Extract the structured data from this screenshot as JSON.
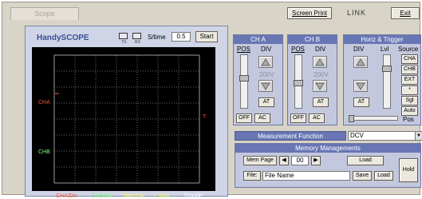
{
  "top": {
    "tab_scope": "Scope",
    "screen_print": "Screen Print",
    "link": "LINK",
    "exit": "Exit"
  },
  "scope": {
    "title": "HandySCOPE",
    "icon1_label": "TX",
    "icon2_label": "RX",
    "stime_label": "S/time",
    "stime_value": "0.5",
    "start_label": "Start",
    "cha_label": "CHA",
    "chb_label": "CHB",
    "trigger_marker": "T",
    "bottom": {
      "cha_div": "CHA/Div",
      "chb_div": "CHB/Div",
      "time_div": "Time/Div",
      "sour": "+  Sour",
      "tmode": "T/mode"
    }
  },
  "cha": {
    "title": "CH A",
    "pos": "POS",
    "div": "DIV",
    "div_value": "200V",
    "at": "AT",
    "off": "OFF",
    "ac": "AC"
  },
  "chb": {
    "title": "CH B",
    "pos": "POS",
    "div": "DIV",
    "div_value": "200V",
    "at": "AT",
    "off": "OFF",
    "ac": "AC"
  },
  "horiz": {
    "title": "Horiz & Trigger",
    "div": "DIV",
    "lvl": "Lvl",
    "source": "Source",
    "at": "AT",
    "sources": [
      "CHA",
      "CHB",
      "EXT",
      "*",
      "Sgl",
      "Auto"
    ],
    "pos": "Pos"
  },
  "measurement": {
    "label": "Measurement Function",
    "value": "DCV"
  },
  "memory": {
    "title": "Memory Managements",
    "mem_page": "Mem Page",
    "page_value": "00",
    "load": "Load",
    "file_label": "File:",
    "file_name": "File Name",
    "save": "Save",
    "load2": "Load",
    "hold": "Hold"
  },
  "colors": {
    "panel_title": "#6876b4",
    "cha_trace": "#ff5030",
    "chb_trace": "#80ff80",
    "time_label": "#ffff60",
    "tmode_label": "#ffffff"
  }
}
